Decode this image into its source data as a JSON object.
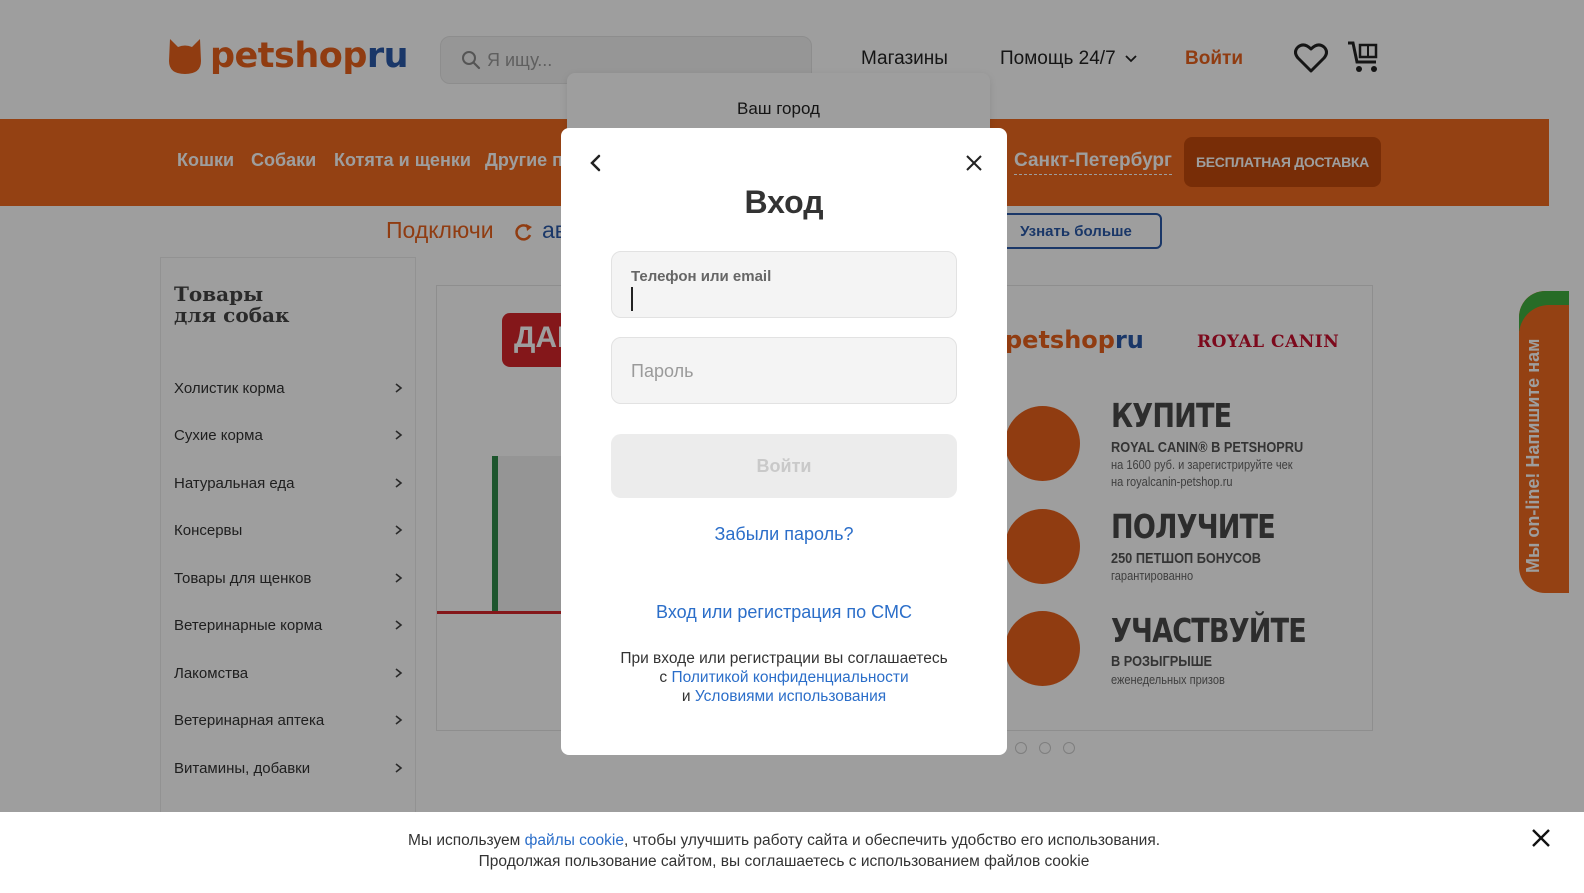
{
  "header": {
    "logo_part1": "petshop",
    "logo_part2": "ru",
    "search_placeholder": "Я ищу...",
    "stores": "Магазины",
    "help": "Помощь 24/7",
    "login": "Войти",
    "accent_color": "#ef6a1f"
  },
  "city_dropdown": {
    "label": "Ваш город"
  },
  "nav": {
    "categories": [
      "Кошки",
      "Собаки",
      "Котята и щенки",
      "Другие п"
    ],
    "city": "Санкт-Петербург",
    "free_delivery": "БЕСПЛАТНАЯ ДОСТАВКА"
  },
  "promo": {
    "text": "Подключи",
    "text2": "ав",
    "learn_more": "Узнать больше"
  },
  "sidebar": {
    "title_line1": "Товары",
    "title_line2": "для собак",
    "items": [
      "Холистик корма",
      "Сухие корма",
      "Натуральная еда",
      "Консервы",
      "Товары для щенков",
      "Ветеринарные корма",
      "Лакомства",
      "Ветеринарная аптека",
      "Витамины, добавки"
    ]
  },
  "banner": {
    "tag": "ДАР",
    "logo_part1": "petshop",
    "logo_part2": "ru",
    "partner": "ROYAL CANIN",
    "steps": [
      {
        "head": "КУПИТЕ",
        "sub": "ROYAL CANIN® В PETSHOPRU",
        "sub2a": "на 1600 руб. и зарегистрируйте чек",
        "sub2b": "на royalcanin-petshop.ru"
      },
      {
        "head": "ПОЛУЧИТЕ",
        "sub": "250 ПЕТШОП БОНУСОВ",
        "sub2a": "гарантированно",
        "sub2b": ""
      },
      {
        "head": "УЧАСТВУЙТЕ",
        "sub": "В РОЗЫГРЫШЕ",
        "sub2a": "еженедельных призов",
        "sub2b": ""
      }
    ]
  },
  "chat": {
    "label": "Мы on-line! Напишите нам"
  },
  "modal": {
    "title": "Вход",
    "login_field_label": "Телефон или email",
    "password_placeholder": "Пароль",
    "submit": "Войти",
    "forgot": "Забыли пароль?",
    "sms": "Вход или регистрация по СМС",
    "consent_line1": "При входе или регистрации вы соглашаетесь",
    "consent_c": "с",
    "consent_privacy": "Политикой конфиденциальности",
    "consent_and": "и",
    "consent_terms": "Условиями использования"
  },
  "cookie": {
    "prefix": "Мы используем",
    "link": "файлы cookie",
    "suffix": ", чтобы улучшить работу сайта и обеспечить удобство его использования.",
    "line2": "Продолжая пользование сайтом, вы соглашаетесь с использованием файлов cookie"
  }
}
